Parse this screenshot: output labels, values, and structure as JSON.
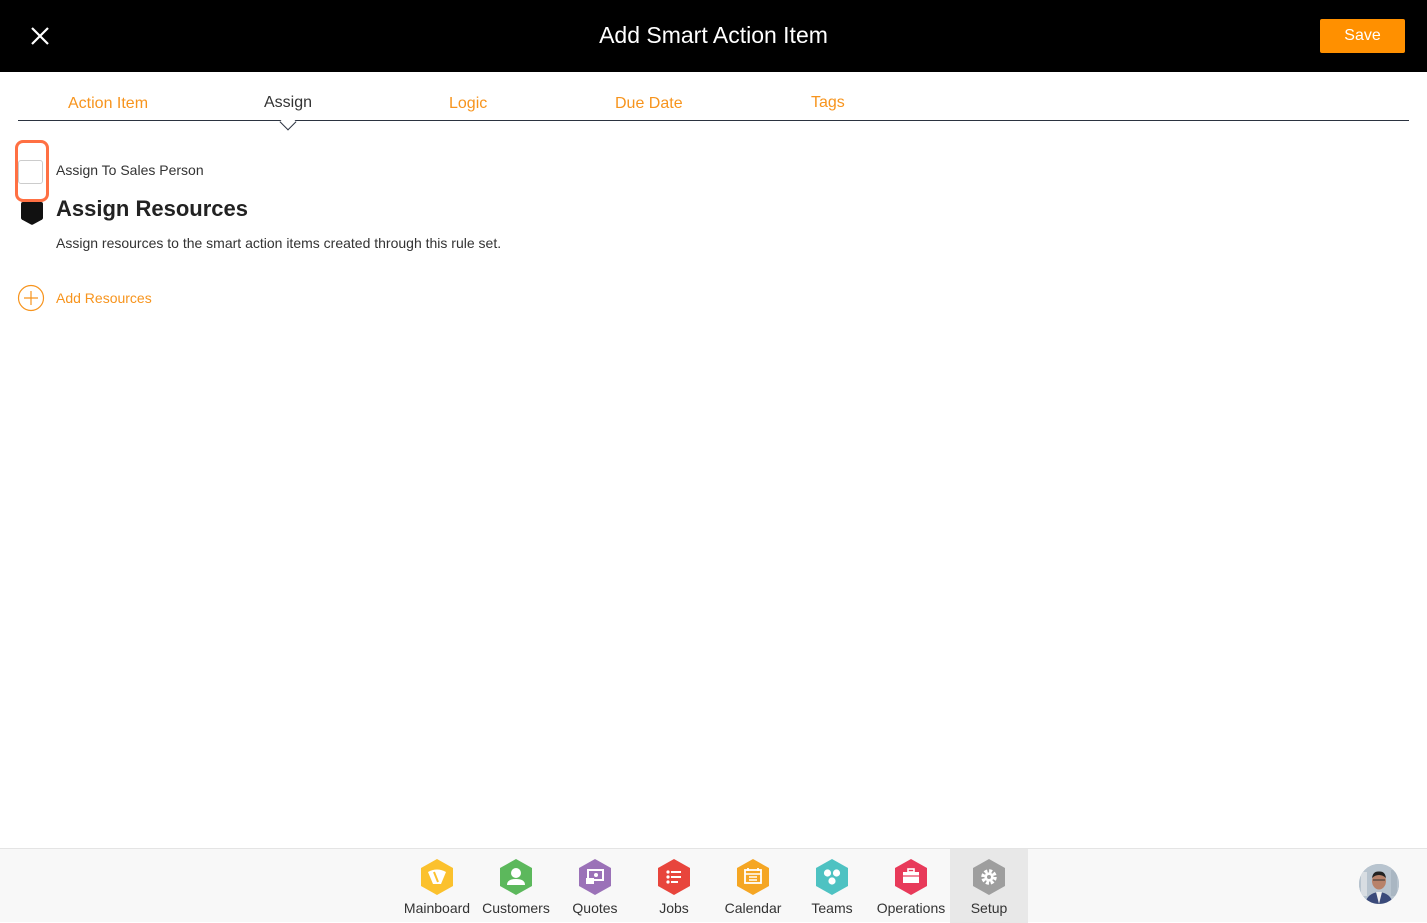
{
  "header": {
    "title": "Add Smart Action Item",
    "save_label": "Save",
    "close_icon": "close-icon"
  },
  "tabs": [
    {
      "label": "Action Item",
      "active": false
    },
    {
      "label": "Assign",
      "active": true
    },
    {
      "label": "Logic",
      "active": false
    },
    {
      "label": "Due Date",
      "active": false
    },
    {
      "label": "Tags",
      "active": false
    }
  ],
  "assign": {
    "checkbox_label": "Assign To Sales Person",
    "checkbox_checked": false,
    "section_title": "Assign Resources",
    "section_description": "Assign resources to the smart action items created through this rule set.",
    "add_resources_label": "Add Resources"
  },
  "bottom_nav": [
    {
      "label": "Mainboard",
      "icon": "mainboard-icon",
      "color": "#fbc12d"
    },
    {
      "label": "Customers",
      "icon": "customer-icon",
      "color": "#5cb85c"
    },
    {
      "label": "Quotes",
      "icon": "quotes-icon",
      "color": "#9b72b8"
    },
    {
      "label": "Jobs",
      "icon": "jobs-list-icon",
      "color": "#e8453c"
    },
    {
      "label": "Calendar",
      "icon": "calendar-icon",
      "color": "#f5a623"
    },
    {
      "label": "Teams",
      "icon": "teams-icon",
      "color": "#4ec2c2"
    },
    {
      "label": "Operations",
      "icon": "briefcase-icon",
      "color": "#e83a5a"
    },
    {
      "label": "Setup",
      "icon": "gear-icon",
      "color": "#9e9e9e",
      "active": true
    }
  ],
  "colors": {
    "accent": "#f7941d",
    "save": "#ff9000",
    "topbar": "#000000",
    "highlight": "#ff7043"
  }
}
